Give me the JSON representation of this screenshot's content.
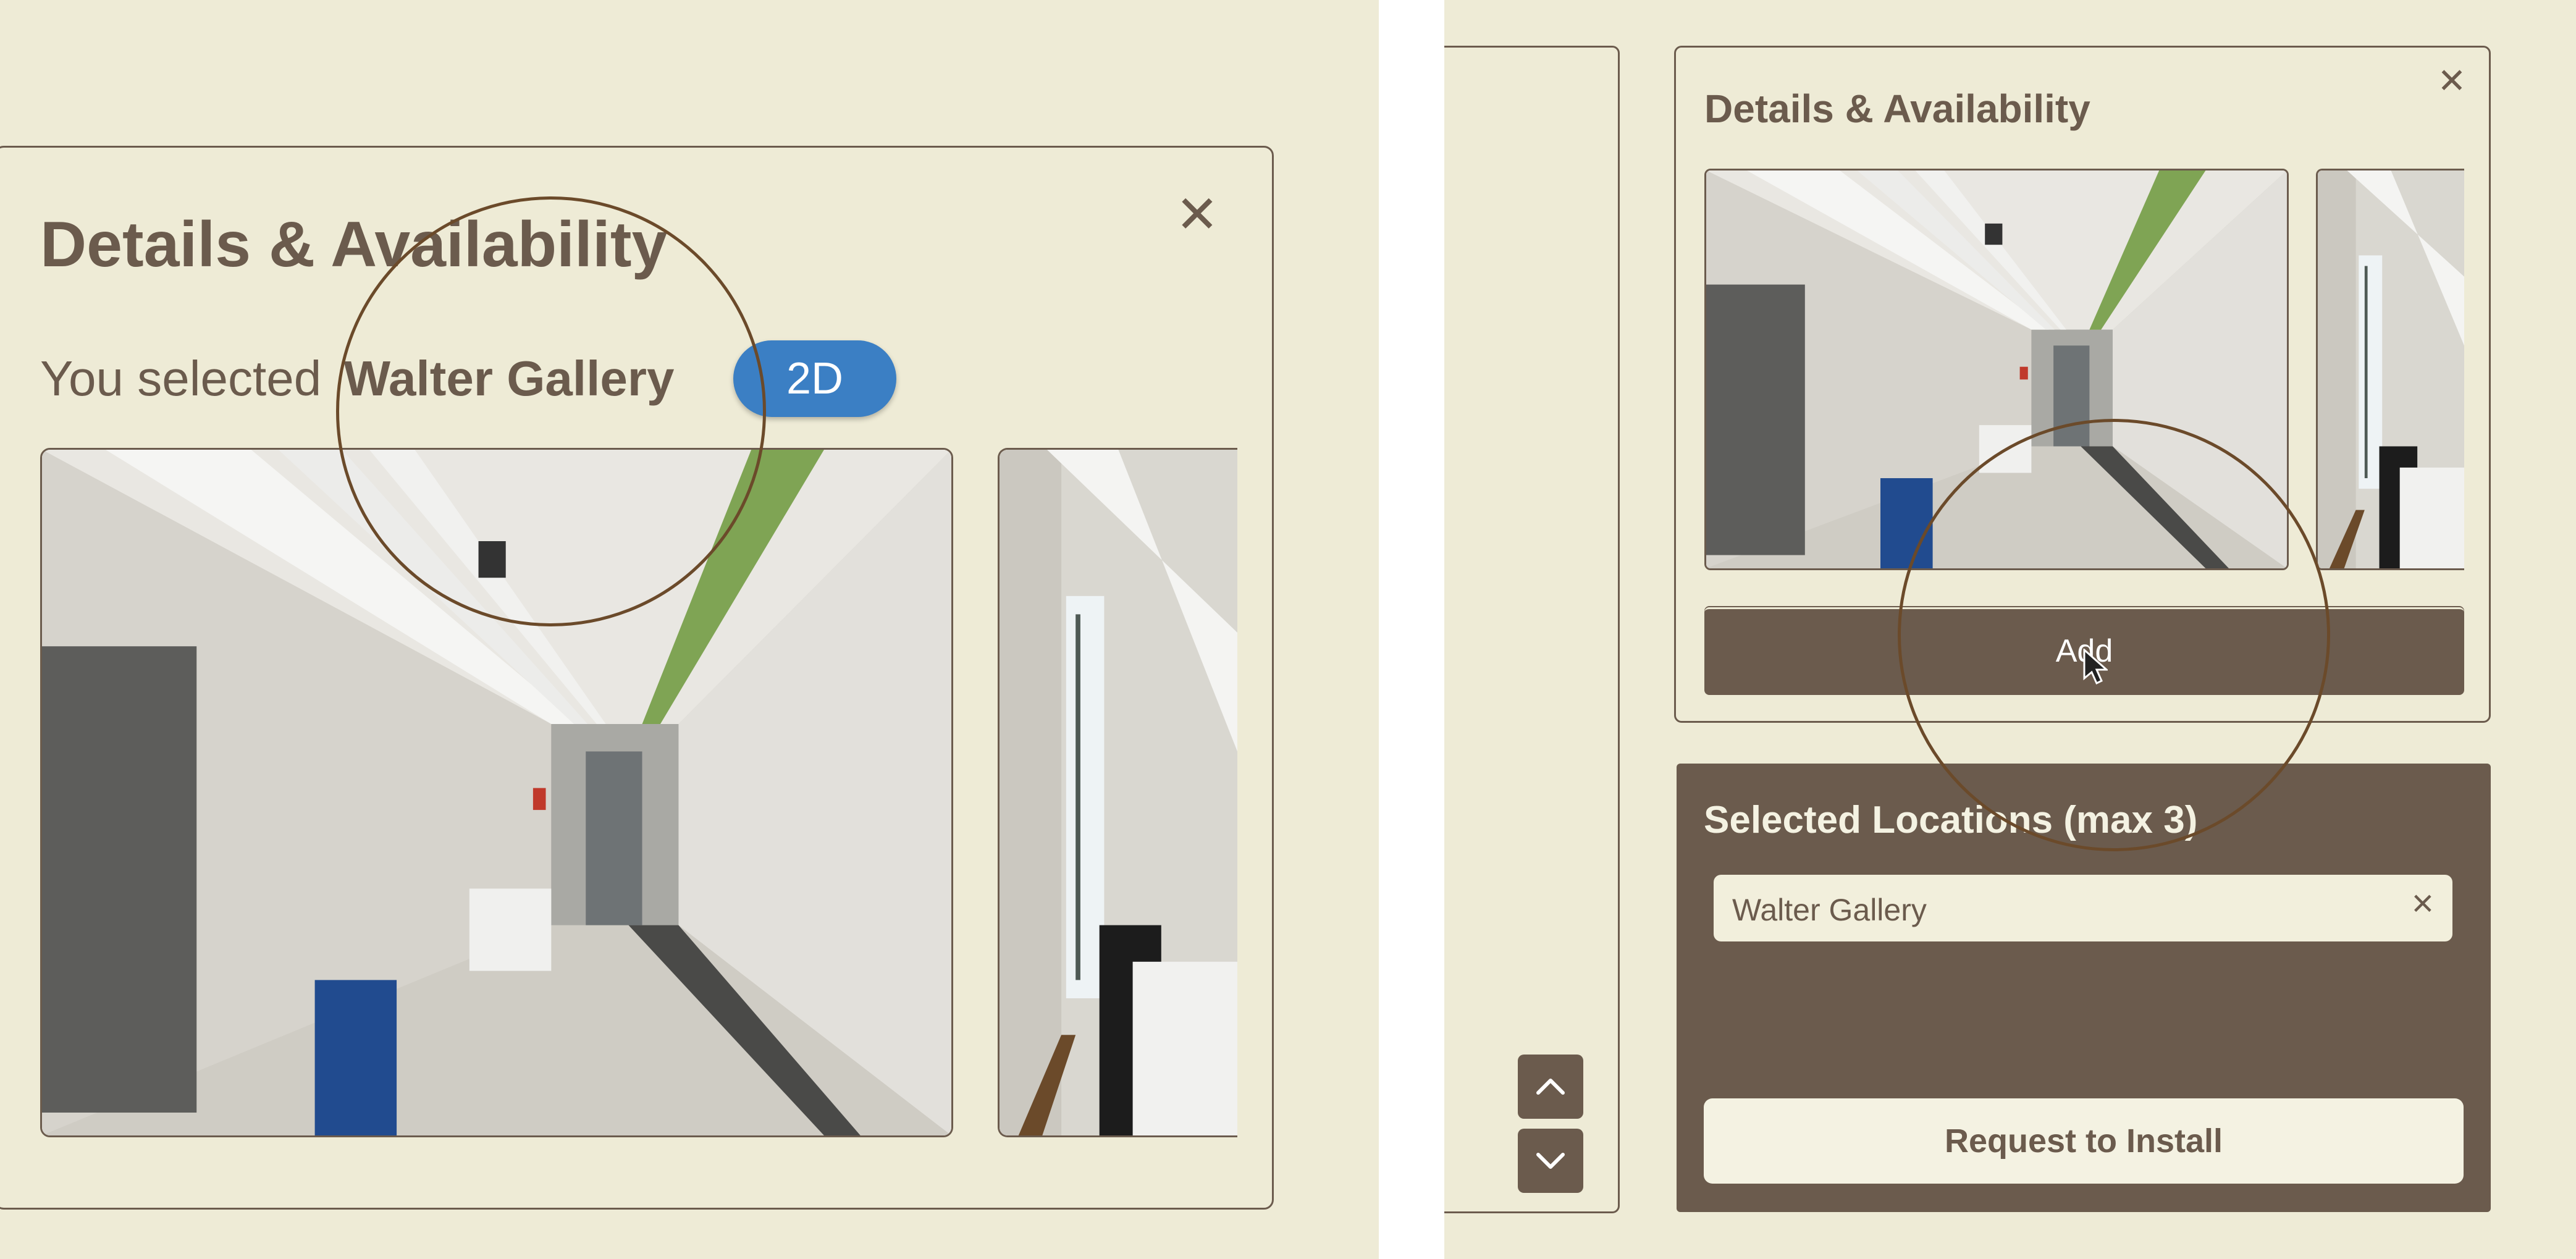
{
  "left": {
    "title": "Details & Availability",
    "close_glyph": "✕",
    "selected_prefix": "You selected",
    "selected_name": "Walter Gallery",
    "badge": "2D",
    "icons": [
      "close-icon"
    ]
  },
  "right": {
    "title": "Details & Availability",
    "close_glyph": "✕",
    "add_label": "Add",
    "selected_heading": "Selected Locations (max 3)",
    "chips": [
      {
        "label": "Walter Gallery",
        "remove_glyph": "×"
      }
    ],
    "request_label": "Request to Install",
    "icons": [
      "close-icon",
      "chevron-up-icon",
      "chevron-down-icon",
      "mouse-cursor-icon"
    ]
  },
  "colors": {
    "background": "#eeebd6",
    "primary": "#6b5b4d",
    "accent_blue": "#3b7fc4",
    "highlight_circle": "#6b4a2a"
  }
}
